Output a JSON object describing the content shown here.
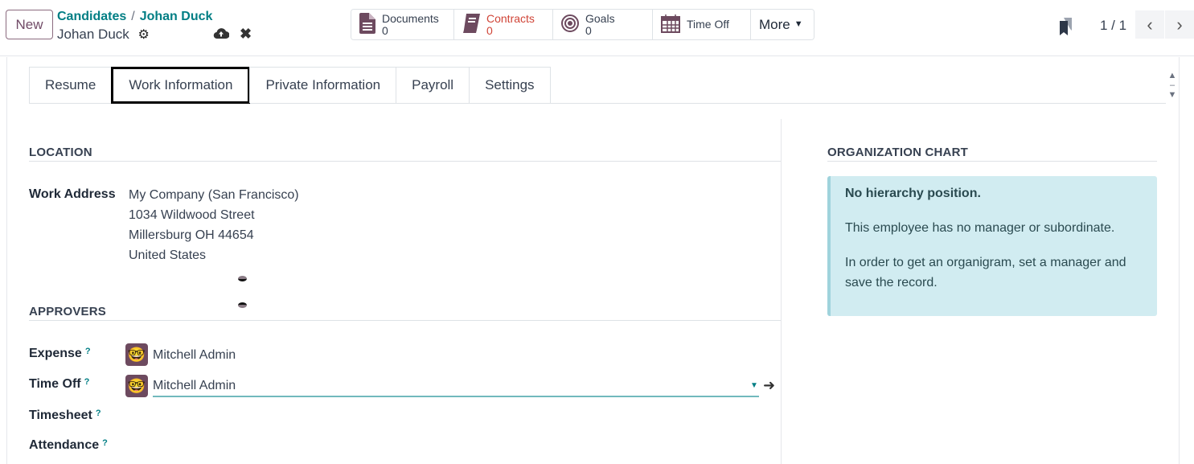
{
  "header": {
    "new_label": "New",
    "breadcrumb": [
      "Candidates",
      "Johan Duck"
    ],
    "record_name": "Johan Duck"
  },
  "smart_buttons": [
    {
      "label": "Documents",
      "count": "0",
      "icon": "document-icon"
    },
    {
      "label": "Contracts",
      "count": "0",
      "icon": "book-icon"
    },
    {
      "label": "Goals",
      "count": "0",
      "icon": "target-icon"
    },
    {
      "label": "Time Off",
      "icon": "calendar-icon"
    }
  ],
  "more_label": "More",
  "pager": "1 / 1",
  "tabs": [
    "Resume",
    "Work Information",
    "Private Information",
    "Payroll",
    "Settings"
  ],
  "location": {
    "title": "LOCATION",
    "label": "Work Address",
    "address": [
      "My Company (San Francisco)",
      "1034 Wildwood Street",
      "Millersburg OH 44654",
      "United States"
    ]
  },
  "approvers": {
    "title": "APPROVERS",
    "fields": [
      {
        "label": "Expense",
        "value": "Mitchell Admin"
      },
      {
        "label": "Time Off",
        "value": "Mitchell Admin"
      },
      {
        "label": "Timesheet",
        "value": ""
      },
      {
        "label": "Attendance",
        "value": ""
      }
    ],
    "help": "?"
  },
  "org_chart": {
    "title": "ORGANIZATION CHART",
    "heading": "No hierarchy position.",
    "line1": "This employee has no manager or subordinate.",
    "line2": "In order to get an organigram, set a manager and save the record."
  },
  "colors": {
    "brand": "#714b67",
    "teal": "#017e84",
    "contracts": "#d04437"
  }
}
